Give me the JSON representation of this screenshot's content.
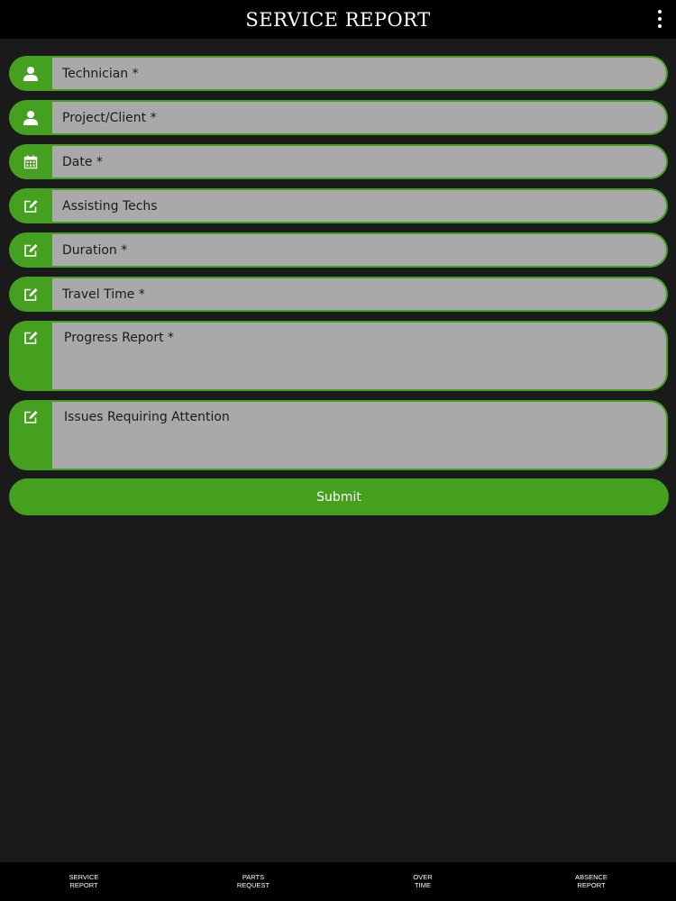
{
  "header": {
    "title": "SERVICE REPORT",
    "menu_icon": "more-vertical-icon"
  },
  "accent_color": "#45a01f",
  "form": {
    "fields": [
      {
        "label": "Technician *",
        "icon": "person-icon"
      },
      {
        "label": "Project/Client *",
        "icon": "person-icon"
      },
      {
        "label": "Date *",
        "icon": "calendar-icon"
      },
      {
        "label": "Assisting Techs",
        "icon": "edit-icon"
      },
      {
        "label": "Duration *",
        "icon": "edit-icon"
      },
      {
        "label": "Travel Time *",
        "icon": "edit-icon"
      },
      {
        "label": "Progress Report *",
        "icon": "edit-icon"
      },
      {
        "label": "Issues Requiring Attention",
        "icon": "edit-icon"
      }
    ],
    "submit_label": "Submit"
  },
  "bottom_nav": {
    "items": [
      {
        "line1": "SERVICE",
        "line2": "REPORT"
      },
      {
        "line1": "PARTS",
        "line2": "REQUEST"
      },
      {
        "line1": "OVER",
        "line2": "TIME"
      },
      {
        "line1": "ABSENCE",
        "line2": "REPORT"
      }
    ]
  }
}
